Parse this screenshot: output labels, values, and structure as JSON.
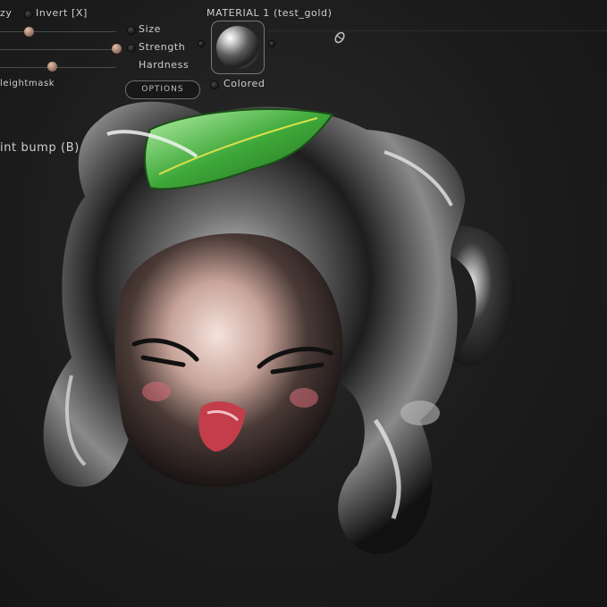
{
  "brush_panel": {
    "lazy_label": "zy",
    "invert_label": "Invert [X]",
    "size_label": "Size",
    "strength_label": "Strength",
    "hardness_label": "Hardness",
    "heightmask_label": "leightmask",
    "options_label": "OPTIONS",
    "sliders": {
      "size": 0.18,
      "strength": 0.97,
      "hardness": 0.4
    }
  },
  "material_panel": {
    "title": "MATERIAL 1 (test_gold)",
    "colored_label": "Colored"
  },
  "tool_label": "int bump (B)",
  "colors": {
    "background": "#1c1c1c",
    "text": "#cfcfcf",
    "leaf_green": "#3fa83a"
  }
}
